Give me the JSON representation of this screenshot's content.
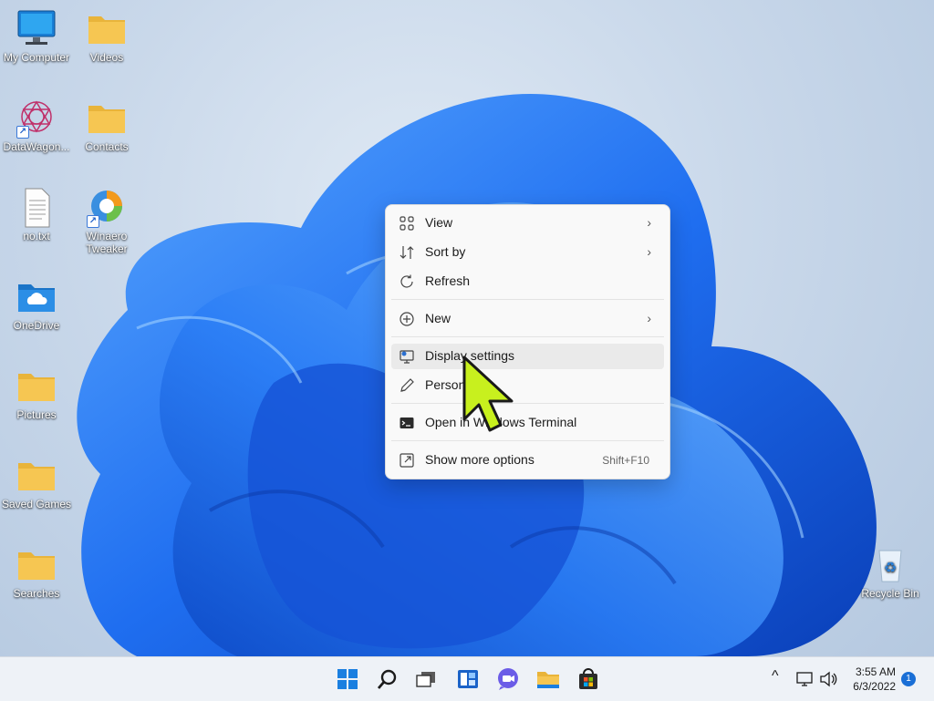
{
  "desktop": {
    "icons": [
      {
        "label": "My Computer",
        "icon": "computer-icon"
      },
      {
        "label": "Videos",
        "icon": "folder-icon"
      },
      {
        "label": "DataWagon...",
        "icon": "datawagon-icon"
      },
      {
        "label": "Contacts",
        "icon": "folder-icon"
      },
      {
        "label": "no.txt",
        "icon": "text-file-icon"
      },
      {
        "label": "Winaero Tweaker",
        "icon": "winaero-icon"
      },
      {
        "label": "OneDrive",
        "icon": "onedrive-folder-icon"
      },
      {
        "label": "Pictures",
        "icon": "folder-icon"
      },
      {
        "label": "Saved Games",
        "icon": "folder-icon"
      },
      {
        "label": "Searches",
        "icon": "folder-icon"
      },
      {
        "label": "Recycle Bin",
        "icon": "recycle-bin-icon"
      }
    ]
  },
  "context_menu": {
    "items": [
      {
        "label": "View",
        "icon": "view-grid-icon",
        "submenu": true
      },
      {
        "label": "Sort by",
        "icon": "sort-icon",
        "submenu": true
      },
      {
        "label": "Refresh",
        "icon": "refresh-icon"
      },
      {
        "label": "New",
        "icon": "new-plus-icon",
        "submenu": true
      },
      {
        "label": "Display settings",
        "icon": "display-settings-icon",
        "highlighted": true
      },
      {
        "label": "Personalize",
        "icon": "personalize-pen-icon"
      },
      {
        "label": "Open in Windows Terminal",
        "icon": "terminal-icon"
      },
      {
        "label": "Show more options",
        "icon": "more-options-icon",
        "shortcut": "Shift+F10"
      }
    ],
    "chevron": "›"
  },
  "taskbar": {
    "buttons": [
      "start-icon",
      "search-icon",
      "task-view-icon",
      "widgets-icon",
      "chat-icon",
      "file-explorer-icon",
      "store-icon"
    ],
    "tray": {
      "overflow_chevron": "^",
      "time": "3:55 AM",
      "date": "6/3/2022",
      "notification_count": "1"
    }
  },
  "colors": {
    "accent": "#1a6fd6",
    "folder": "#f6c652",
    "cursor": "#c8f01e"
  }
}
